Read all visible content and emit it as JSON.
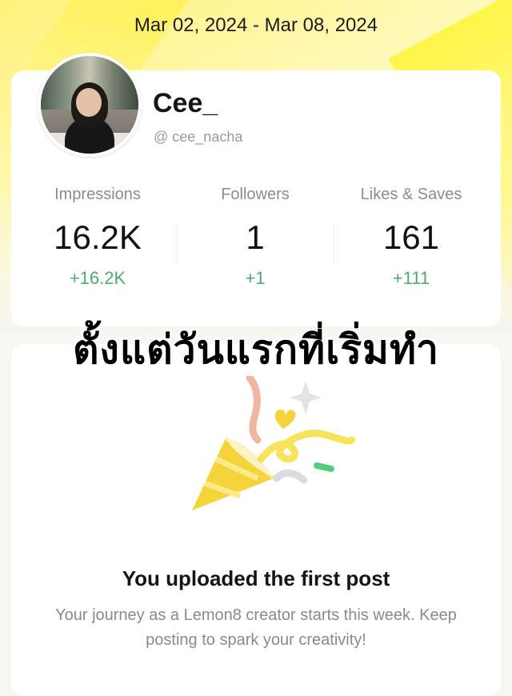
{
  "header": {
    "date_range": "Mar 02, 2024 - Mar 08, 2024"
  },
  "profile": {
    "name": "Cee_",
    "handle": "@ cee_nacha"
  },
  "stats": [
    {
      "label": "Impressions",
      "value": "16.2K",
      "delta": "+16.2K"
    },
    {
      "label": "Followers",
      "value": "1",
      "delta": "+1"
    },
    {
      "label": "Likes & Saves",
      "value": "161",
      "delta": "+111"
    }
  ],
  "overlay_caption": "ตั้งแต่วันแรกที่เริ่มทำ",
  "milestone": {
    "title": "You uploaded the first post",
    "description": "Your journey as a Lemon8 creator starts this week. Keep posting to spark your creativity!",
    "illustration": "party-popper-icon"
  },
  "colors": {
    "accent_yellow": "#fff27a",
    "delta_green": "#4cae6e"
  }
}
